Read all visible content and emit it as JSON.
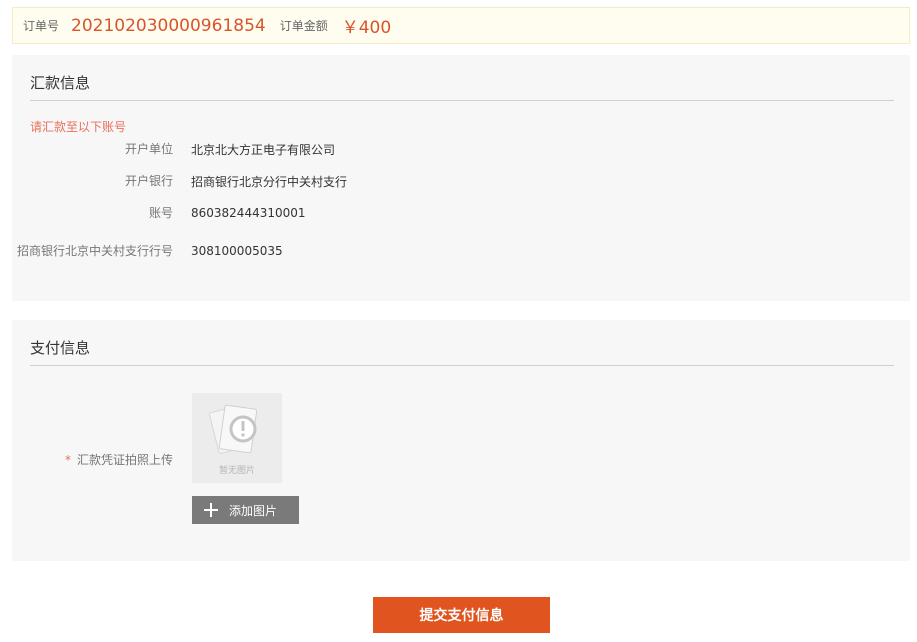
{
  "order": {
    "number_label": "订单号",
    "number_value": "202102030000961854",
    "amount_label": "订单金额",
    "amount_value": "￥400"
  },
  "remit": {
    "title": "汇款信息",
    "notice": "请汇款至以下账号",
    "rows": [
      {
        "label": "开户单位",
        "value": "北京北大方正电子有限公司"
      },
      {
        "label": "开户银行",
        "value": "招商银行北京分行中关村支行"
      },
      {
        "label": "账号",
        "value": "860382444310001"
      },
      {
        "label": "招商银行北京中关村支行行号",
        "value": "308100005035"
      }
    ]
  },
  "payment": {
    "title": "支付信息",
    "required_mark": "*",
    "upload_label": "汇款凭证拍照上传",
    "placeholder_text": "暂无图片",
    "add_image_label": "添加图片"
  },
  "submit_label": "提交支付信息",
  "colors": {
    "accent": "#e0541f",
    "highlight_text": "#d9542b",
    "notice_text": "#e8705a",
    "button_gray": "#7a7a7a"
  },
  "icons": {
    "thumb": "no-image-placeholder-icon",
    "add": "plus-icon"
  }
}
